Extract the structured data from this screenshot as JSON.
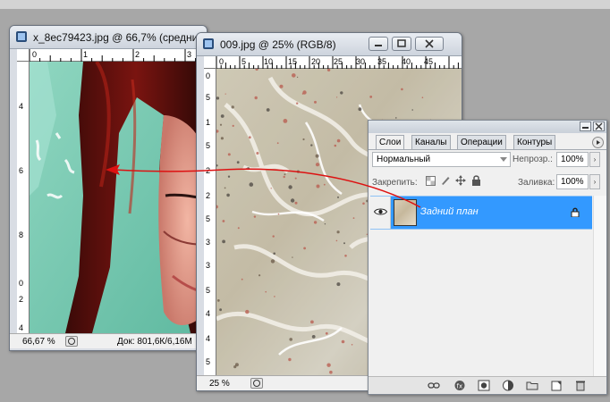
{
  "window1": {
    "title": "x_8ec79423.jpg @ 66,7% (средни",
    "zoom": "66,67 %",
    "doc_info": "Док: 801,6К/6,16М",
    "ruler_h": [
      "0",
      "1",
      "2",
      "3"
    ],
    "ruler_v": [
      "4",
      "6",
      "8",
      "0",
      "2",
      "4"
    ]
  },
  "window2": {
    "title": "009.jpg @ 25% (RGB/8)",
    "zoom": "25 %",
    "ruler_h": [
      "0",
      "5",
      "10",
      "15",
      "20",
      "25",
      "30",
      "35",
      "40",
      "45"
    ],
    "ruler_v": [
      "0",
      "5",
      "1",
      "5",
      "2",
      "2",
      "5",
      "3",
      "3",
      "5",
      "4",
      "4",
      "5"
    ]
  },
  "layers_panel": {
    "tabs": [
      "Слои",
      "Каналы",
      "Операции",
      "Контуры"
    ],
    "blend_mode": "Нормальный",
    "opacity_label": "Непрозр.:",
    "opacity_value": "100%",
    "lock_label": "Закрепить:",
    "fill_label": "Заливка:",
    "fill_value": "100%",
    "layers": [
      {
        "name": "Задний план",
        "visible": true,
        "locked": true,
        "selected": true
      }
    ],
    "footer_icons": [
      "link-icon",
      "fx-icon",
      "mask-icon",
      "adjustment-icon",
      "folder-icon",
      "new-layer-icon",
      "trash-icon"
    ]
  },
  "colors": {
    "selection": "#3399ff",
    "arrow": "#dd1111"
  }
}
